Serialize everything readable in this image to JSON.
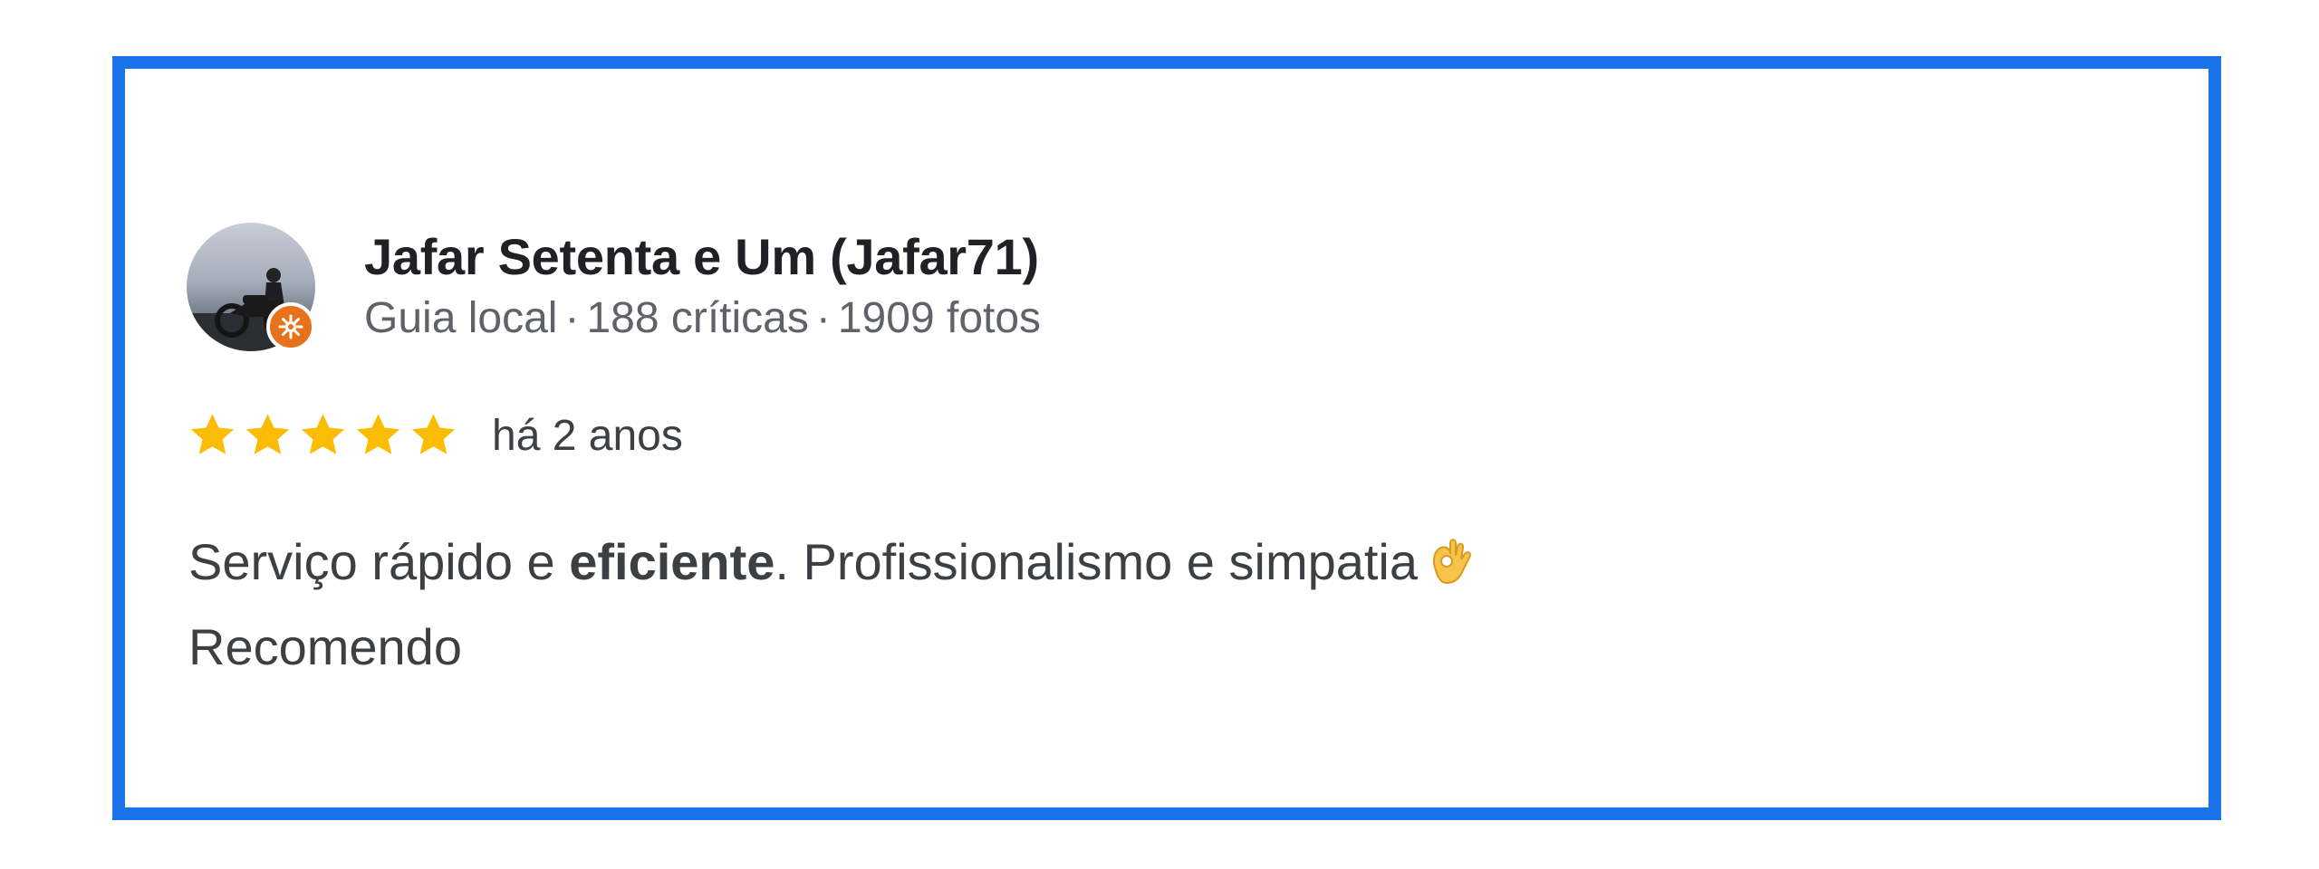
{
  "review": {
    "author_name": "Jafar Setenta e Um (Jafar71)",
    "badge": "Guia local",
    "reviews_count": "188 críticas",
    "photos_count": "1909 fotos",
    "separator": "·",
    "rating": 5,
    "rating_max": 5,
    "time_ago": "há 2 anos",
    "text_part1": "Serviço rápido e ",
    "text_bold": "eficiente",
    "text_part2": ". Profissionalismo e simpatia",
    "text_emoji": "ok-hand-emoji",
    "text_line2": "Recomendo"
  },
  "colors": {
    "frame_border": "#1a73e8",
    "star": "#fbbc04",
    "local_guide_badge": "#e8711c"
  }
}
